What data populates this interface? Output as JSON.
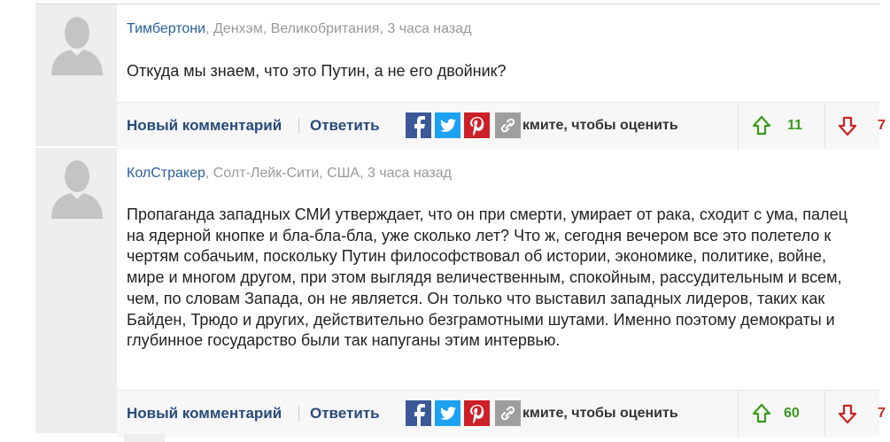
{
  "comments": [
    {
      "author": "Тимбертони",
      "location_time": ", Денхэм, Великобритания, 3 часа назад",
      "text": "Откуда мы знаем, что это Путин, а не его двойник?",
      "new_comment_label": "Новый комментарий",
      "reply_label": "Ответить",
      "rate_label": "кмите, чтобы оценить",
      "upvotes": "11",
      "downvotes": "7"
    },
    {
      "author": "КолСтракер",
      "location_time": ", Солт-Лейк-Сити, США, 3 часа назад",
      "text": "Пропаганда западных СМИ утверждает, что он при смерти, умирает от рака, сходит с ума, палец на ядерной кнопке и бла-бла-бла, уже сколько лет? Что ж, сегодня вечером все это полетело к чертям собачьим, поскольку Путин философствовал об истории, экономике, политике, войне, мире и многом другом, при этом выглядя величественным, спокойным, рассудительным и всем, чем, по словам Запада, он не является. Он только что выставил западных лидеров, таких как Байден, Трюдо и других, действительно безграмотными шутами. Именно поэтому демократы и глубинное государство были так напуганы этим интервью.",
      "new_comment_label": "Новый комментарий",
      "reply_label": "Ответить",
      "rate_label": "кмите, чтобы оценить",
      "upvotes": "60",
      "downvotes": "7"
    }
  ],
  "icons": {
    "facebook": "facebook-icon",
    "twitter": "twitter-icon",
    "pinterest": "pinterest-icon",
    "link": "link-icon",
    "upvote": "arrow-up-icon",
    "downvote": "arrow-down-icon",
    "avatar": "avatar-silhouette-icon"
  },
  "colors": {
    "facebook": "#3b5998",
    "twitter": "#1da1f2",
    "pinterest": "#cb2027",
    "link": "#9e9e9e",
    "up": "#3a9a1c",
    "down": "#cc2222",
    "author": "#2a5f9e",
    "action": "#274a7a"
  }
}
